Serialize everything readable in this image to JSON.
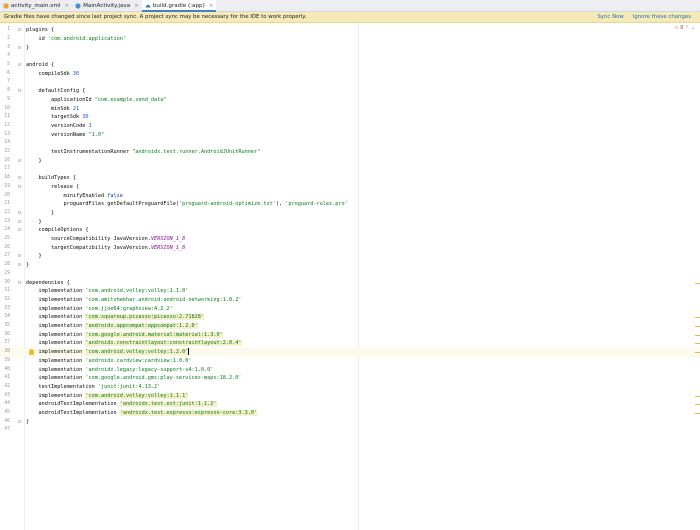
{
  "tabs": [
    {
      "label": "activity_main.xml",
      "icon": "xml-file-icon",
      "active": false
    },
    {
      "label": "MainActivity.java",
      "icon": "java-class-icon",
      "active": false
    },
    {
      "label": "build.gradle (:app)",
      "icon": "gradle-file-icon",
      "active": true
    }
  ],
  "banner": {
    "message": "Gradle files have changed since last project sync. A project sync may be necessary for the IDE to work properly.",
    "sync_now": "Sync Now",
    "ignore": "Ignore these changes"
  },
  "inspections": {
    "warning_count": "8",
    "icon": "warning-icon"
  },
  "colors": {
    "string": "#067d17",
    "number": "#1750eb",
    "keyword": "#0033b3",
    "constant": "#871094",
    "accent": "#4083c9",
    "banner": "#f5eab8"
  },
  "current_line": 38,
  "code_lines": [
    "plugins {",
    "    id 'com.android.application'",
    "}",
    "",
    "android {",
    "    compileSdk 30",
    "",
    "    defaultConfig {",
    "        applicationId \"com.example.send_data\"",
    "        minSdk 21",
    "        targetSdk 30",
    "        versionCode 1",
    "        versionName \"1.0\"",
    "",
    "        testInstrumentationRunner \"androidx.test.runner.AndroidJUnitRunner\"",
    "    }",
    "",
    "    buildTypes {",
    "        release {",
    "            minifyEnabled false",
    "            proguardFiles getDefaultProguardFile('proguard-android-optimize.txt'), 'proguard-rules.pro'",
    "        }",
    "    }",
    "    compileOptions {",
    "        sourceCompatibility JavaVersion.VERSION_1_8",
    "        targetCompatibility JavaVersion.VERSION_1_8",
    "    }",
    "}",
    "",
    "dependencies {",
    "    implementation 'com.android.volley:volley:1.1.0'",
    "    implementation 'com.amitshekhar.android:android-networking:1.0.2'",
    "    implementation 'com.jjoe64:graphview:4.2.2'",
    "    implementation 'com.squareup.picasso:picasso:2.71828'",
    "    implementation 'androidx.appcompat:appcompat:1.2.0'",
    "    implementation 'com.google.android.material:material:1.3.0'",
    "    implementation 'androidx.constraintlayout:constraintlayout:2.0.4'",
    "    implementation 'com.android.volley:volley:1.2.0'",
    "    implementation 'androidx.cardview:cardview:1.0.0'",
    "    implementation 'androidx.legacy:legacy-support-v4:1.0.0'",
    "    implementation 'com.google.android.gms:play-services-maps:18.2.0'",
    "    testImplementation 'junit:junit:4.13.2'",
    "    implementation 'com.android.volley:volley:1.1.1'",
    "    androidTestImplementation 'androidx.test.ext:junit:1.1.2'",
    "    androidTestImplementation 'androidx.test.espresso:espresso-core:3.3.0'",
    "}",
    ""
  ],
  "highlighted_lines": [
    30,
    34,
    35,
    36,
    37,
    38,
    43,
    44,
    45
  ]
}
